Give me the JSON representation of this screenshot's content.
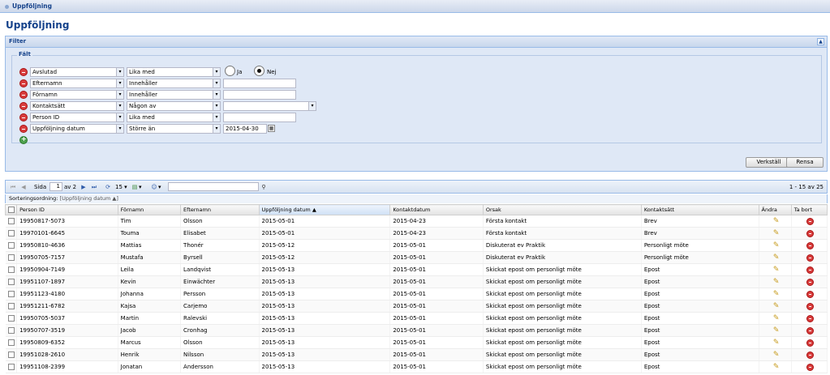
{
  "tab": {
    "label": "Uppföljning"
  },
  "page": {
    "title": "Uppföljning"
  },
  "filter": {
    "title": "Filter",
    "legend": "Fält",
    "rows": [
      {
        "field": "Avslutad",
        "operator": "Lika med",
        "radio_yes": "Ja",
        "radio_no": "Nej"
      },
      {
        "field": "Efternamn",
        "operator": "Innehåller",
        "value": ""
      },
      {
        "field": "Förnamn",
        "operator": "Innehåller",
        "value": ""
      },
      {
        "field": "Kontaktsätt",
        "operator": "Någon av",
        "value": ""
      },
      {
        "field": "Person ID",
        "operator": "Lika med",
        "value": ""
      },
      {
        "field": "Uppföljning datum",
        "operator": "Större än",
        "value": "2015-04-30"
      }
    ],
    "apply_label": "Verkställ",
    "clear_label": "Rensa"
  },
  "toolbar": {
    "page_label": "Sida",
    "page_value": "1",
    "of_label": "av 2",
    "page_size": "15",
    "range_text": "1 - 15 av 25"
  },
  "sort": {
    "label": "Sorteringsordning:",
    "value": "[Uppföljning datum"
  },
  "grid": {
    "columns": [
      "Person ID",
      "Förnamn",
      "Efternamn",
      "Uppföljning datum",
      "Kontaktdatum",
      "Orsak",
      "Kontaktsätt",
      "Ändra",
      "Ta bort"
    ],
    "rows": [
      [
        "19950817-5073",
        "Tim",
        "Olsson",
        "2015-05-01",
        "2015-04-23",
        "Första kontakt",
        "Brev"
      ],
      [
        "19970101-6645",
        "Touma",
        "Elisabet",
        "2015-05-01",
        "2015-04-23",
        "Första kontakt",
        "Brev"
      ],
      [
        "19950810-4636",
        "Mattias",
        "Thonér",
        "2015-05-12",
        "2015-05-01",
        "Diskuterat ev Praktik",
        "Personligt möte"
      ],
      [
        "19950705-7157",
        "Mustafa",
        "Byrsell",
        "2015-05-12",
        "2015-05-01",
        "Diskuterat ev Praktik",
        "Personligt möte"
      ],
      [
        "19950904-7149",
        "Leila",
        "Landqvist",
        "2015-05-13",
        "2015-05-01",
        "Skickat epost om personligt möte",
        "Epost"
      ],
      [
        "19951107-1897",
        "Kevin",
        "Einwächter",
        "2015-05-13",
        "2015-05-01",
        "Skickat epost om personligt möte",
        "Epost"
      ],
      [
        "19951123-4180",
        "Johanna",
        "Persson",
        "2015-05-13",
        "2015-05-01",
        "Skickat epost om personligt möte",
        "Epost"
      ],
      [
        "19951211-6782",
        "Kajsa",
        "Carjemo",
        "2015-05-13",
        "2015-05-01",
        "Skickat epost om personligt möte",
        "Epost"
      ],
      [
        "19950705-5037",
        "Martin",
        "Ralevski",
        "2015-05-13",
        "2015-05-01",
        "Skickat epost om personligt möte",
        "Epost"
      ],
      [
        "19950707-3519",
        "Jacob",
        "Cronhag",
        "2015-05-13",
        "2015-05-01",
        "Skickat epost om personligt möte",
        "Epost"
      ],
      [
        "19950809-6352",
        "Marcus",
        "Olsson",
        "2015-05-13",
        "2015-05-01",
        "Skickat epost om personligt möte",
        "Epost"
      ],
      [
        "19951028-2610",
        "Henrik",
        "Nilsson",
        "2015-05-13",
        "2015-05-01",
        "Skickat epost om personligt möte",
        "Epost"
      ],
      [
        "19951108-2399",
        "Jonatan",
        "Andersson",
        "2015-05-13",
        "2015-05-01",
        "Skickat epost om personligt möte",
        "Epost"
      ]
    ]
  }
}
